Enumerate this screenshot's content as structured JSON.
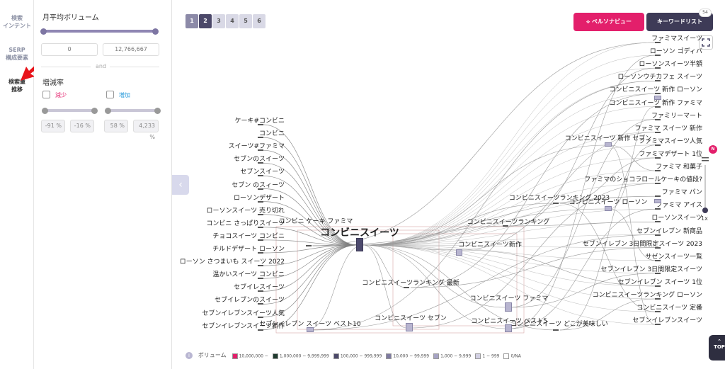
{
  "nav": {
    "items": [
      {
        "label_line1": "検索",
        "label_line2": "インテント"
      },
      {
        "label_line1": "SERP",
        "label_line2": "構成要素"
      },
      {
        "label_line1": "検索量",
        "label_line2": "推移"
      }
    ]
  },
  "filters": {
    "volume_title": "月平均ボリューム",
    "volume_min": "0",
    "volume_max": "12,766,667",
    "and_label": "and",
    "rate_title": "増減率",
    "decrease_label": "減少",
    "increase_label": "増加",
    "decrease_min": "-91",
    "decrease_max": "-16",
    "increase_min": "58",
    "increase_max": "4,233",
    "percent": "%",
    "decrease_color": "#e31f6b",
    "increase_color": "#2d9cdb"
  },
  "toolbar": {
    "pages": [
      "1",
      "2",
      "3",
      "4",
      "5",
      "6"
    ],
    "persona_label": "ペルソナビュー",
    "keyword_list_label": "キーワードリスト",
    "keyword_count": "54",
    "zoom_badge": "N",
    "zoom_level": "1x",
    "zoom_fraction": 0.0,
    "top_label": "TOP"
  },
  "graph": {
    "center_label": "コンビニスイーツ",
    "left_labels": [
      "ケーキ#コンビニ",
      "コンビニ",
      "スイーツ#ファミマ",
      "セブンのスイーツ",
      "セブンスイーツ",
      "セブン のスィーツ",
      "ローソンデザート",
      "ローソンスイーツ 売り切れ",
      "コンビニ さっぱりスイーツ",
      "チョコスイーツ コンビニ",
      "チルドデザート ローソン",
      "ローソン さつまいも スイーツ 2022",
      "温かいスイーツ コンビニ",
      "セブイレスイーツ",
      "セブイレブンのスイーツ",
      "セブンイレブンスイーツ人気",
      "セブンイレブンスイーツ新作"
    ],
    "middle_labels": [
      "コンビニ ケーキ ファミマ",
      "コンビニスイーツ新作",
      "コンビニスイーツランキング",
      "コンビニスイーツランキング 2023",
      "コンビニスイーツランキング 最新",
      "コンビニスイーツ セブン",
      "コンビニスイーツ ファミマ",
      "コンビニスイーツ ベスト5",
      "コンビニスイーツ どこが美味しい",
      "セブンイレブン スイーツ ベスト10",
      "コンビニスイーツ 新作 セブン",
      "コンビニスイーツ ローソン"
    ],
    "right_labels": [
      "ファミマスイーツ",
      "ローソン ゴディバ",
      "ローソンスイーツ半額",
      "ローソンウチカフェ スイーツ",
      "コンビニスイーツ 新作 ローソン",
      "コンビニスイーツ 新作 ファミマ",
      "ファミリーマート",
      "ファミマ スイーツ 新作",
      "ファミマスイーツ人気",
      "ファミマデザート 1位",
      "ファミマ 和菓子",
      "ファミマのショコラロールケーキの値段?",
      "ファミマ パン",
      "ファミマ アイス",
      "ローソンスイーツ",
      "セブンイレブン 新商品",
      "セブンイレブン 3日間限定スイーツ 2023",
      "サゼンスイーツ一覧",
      "セブンイレブン 3日間限定スイーツ",
      "セブンイレブン スイーツ 1位",
      "コンビニスイーツランキング ローソン",
      "コンビニスイーツ 定番",
      "セブンイレブンスイーツ"
    ]
  },
  "legend": {
    "title": "ボリューム",
    "items": [
      {
        "label": "10,000,000 ~",
        "color": "#e31f6b"
      },
      {
        "label": "1,000,000 ~ 9,999,999",
        "color": "#1f3a2e"
      },
      {
        "label": "100,000 ~ 999,999",
        "color": "#4b4869"
      },
      {
        "label": "10,000 ~ 99,999",
        "color": "#7e7aa0"
      },
      {
        "label": "1,000 ~ 9,999",
        "color": "#a6a3c4"
      },
      {
        "label": "1 ~ 999",
        "color": "#d2d0e3"
      },
      {
        "label": "0/NA",
        "color": "#ffffff"
      }
    ]
  }
}
